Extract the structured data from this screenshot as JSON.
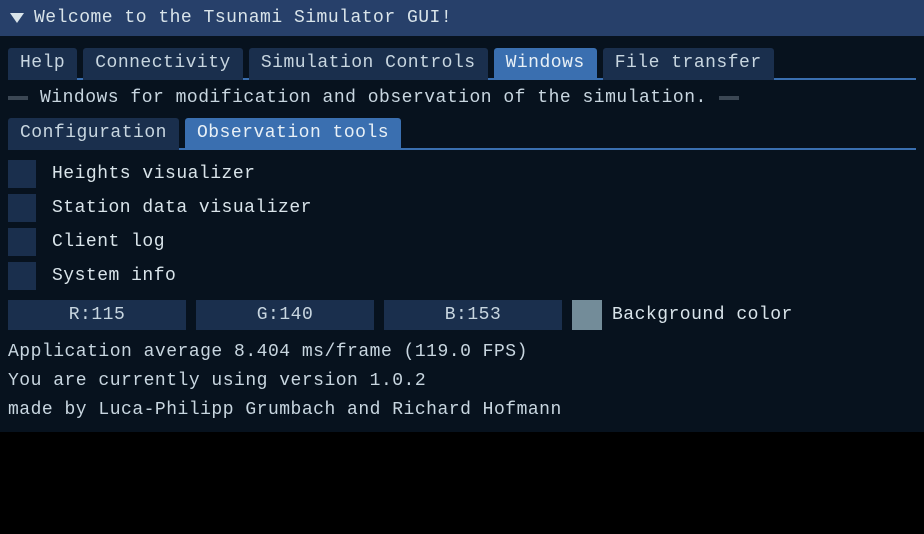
{
  "window": {
    "title": "Welcome to the Tsunami Simulator GUI!"
  },
  "tabs": {
    "items": [
      {
        "label": "Help"
      },
      {
        "label": "Connectivity"
      },
      {
        "label": "Simulation Controls"
      },
      {
        "label": "Windows"
      },
      {
        "label": "File transfer"
      }
    ],
    "active_index": 3
  },
  "subheader": "Windows for modification and observation of the simulation.",
  "subtabs": {
    "items": [
      {
        "label": "Configuration"
      },
      {
        "label": "Observation tools"
      }
    ],
    "active_index": 1
  },
  "observation_tools": {
    "checkboxes": [
      {
        "label": "Heights visualizer",
        "checked": false
      },
      {
        "label": "Station data visualizer",
        "checked": false
      },
      {
        "label": "Client log",
        "checked": false
      },
      {
        "label": "System info",
        "checked": false
      }
    ]
  },
  "background_color": {
    "r_label": "R:115",
    "g_label": "G:140",
    "b_label": "B:153",
    "r": 115,
    "g": 140,
    "b": 153,
    "field_label": "Background color",
    "swatch_hex": "#738c99"
  },
  "status": {
    "perf_line": "Application average 8.404 ms/frame (119.0 FPS)",
    "ms_per_frame": 8.404,
    "fps": 119.0,
    "version_line": "You are currently using version 1.0.2",
    "version": "1.0.2",
    "credits_line": "made by Luca-Philipp Grumbach and Richard Hofmann"
  }
}
